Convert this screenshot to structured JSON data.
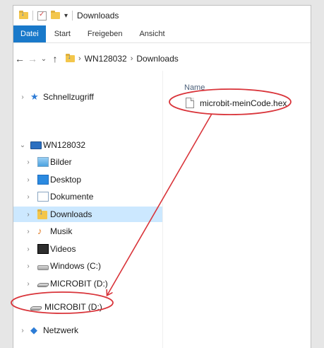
{
  "window": {
    "title": "Downloads"
  },
  "ribbon": {
    "tabs": [
      "Datei",
      "Start",
      "Freigeben",
      "Ansicht"
    ]
  },
  "address": {
    "segments": [
      "WN128032",
      "Downloads"
    ]
  },
  "nav": {
    "items": [
      {
        "label": "Schnellzugriff",
        "icon": "star-icon"
      },
      {
        "label": "WN128032",
        "icon": "computer-icon"
      },
      {
        "label": "Bilder",
        "icon": "pictures-folder-icon"
      },
      {
        "label": "Desktop",
        "icon": "desktop-folder-icon"
      },
      {
        "label": "Dokumente",
        "icon": "documents-folder-icon"
      },
      {
        "label": "Downloads",
        "icon": "downloads-folder-icon",
        "selected": true
      },
      {
        "label": "Musik",
        "icon": "music-folder-icon"
      },
      {
        "label": "Videos",
        "icon": "videos-folder-icon"
      },
      {
        "label": "Windows (C:)",
        "icon": "system-drive-icon"
      },
      {
        "label": "MICROBIT (D:)",
        "icon": "usb-drive-icon"
      },
      {
        "label": "MICROBIT (D:)",
        "icon": "usb-drive-icon"
      },
      {
        "label": "Netzwerk",
        "icon": "network-icon"
      }
    ]
  },
  "content": {
    "column_header": "Name",
    "files": [
      {
        "name": "microbit-meinCode.hex",
        "icon": "file-icon"
      }
    ]
  },
  "annotation": {
    "color": "#d9343a"
  }
}
